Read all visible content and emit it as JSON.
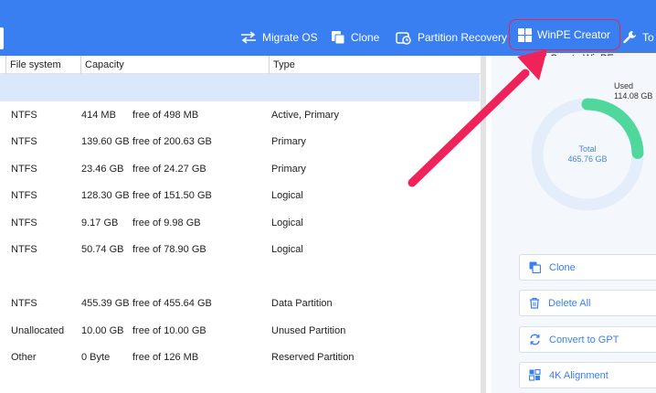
{
  "toolbar": {
    "items": [
      {
        "label": "Migrate OS",
        "icon": "migrate-arrows-icon"
      },
      {
        "label": "Clone",
        "icon": "clone-icon"
      },
      {
        "label": "Partition Recovery",
        "icon": "partition-recovery-icon"
      },
      {
        "label": "WinPE Creator",
        "icon": "windows-icon"
      },
      {
        "label": "To",
        "icon": "wrench-icon"
      }
    ],
    "tooltip": "Create WinPE emergenc"
  },
  "table": {
    "columns": [
      "File system",
      "Capacity",
      "Type"
    ],
    "rows": [
      {
        "fs": "NTFS",
        "used": "414 MB",
        "free": "free of 498 MB",
        "type": "Active, Primary"
      },
      {
        "fs": "NTFS",
        "used": "139.60 GB",
        "free": "free of 200.63 GB",
        "type": "Primary"
      },
      {
        "fs": "NTFS",
        "used": "23.46 GB",
        "free": "free of 24.27 GB",
        "type": "Primary"
      },
      {
        "fs": "NTFS",
        "used": "128.30 GB",
        "free": "free of 151.50 GB",
        "type": "Logical"
      },
      {
        "fs": "NTFS",
        "used": "9.17 GB",
        "free": "free of 9.98 GB",
        "type": "Logical"
      },
      {
        "fs": "NTFS",
        "used": "50.74 GB",
        "free": "free of 78.90 GB",
        "type": "Logical"
      },
      {
        "fs": "NTFS",
        "used": "455.39 GB",
        "free": "free of 455.64 GB",
        "type": "Data Partition"
      },
      {
        "fs": "Unallocated",
        "used": "10.00 GB",
        "free": "free of 10.00 GB",
        "type": "Unused Partition"
      },
      {
        "fs": "Other",
        "used": "0 Byte",
        "free": "free of 126 MB",
        "type": "Reserved Partition"
      }
    ]
  },
  "disk": {
    "used_label": "Used",
    "used_value": "114.08 GB",
    "total_label": "Total",
    "total_value": "465.76 GB",
    "used_fraction": 0.245,
    "colors": {
      "used": "#4fd79c",
      "free": "#e4eefb",
      "text": "#4a86d8"
    }
  },
  "operations": [
    {
      "label": "Clone",
      "icon": "clone-icon"
    },
    {
      "label": "Delete All",
      "icon": "trash-icon"
    },
    {
      "label": "Convert to GPT",
      "icon": "convert-icon"
    },
    {
      "label": "4K Alignment",
      "icon": "alignment-icon"
    }
  ],
  "colors": {
    "accent": "#3a7ff2",
    "highlight": "#e8234e",
    "selected_row": "#dbe8fb"
  }
}
